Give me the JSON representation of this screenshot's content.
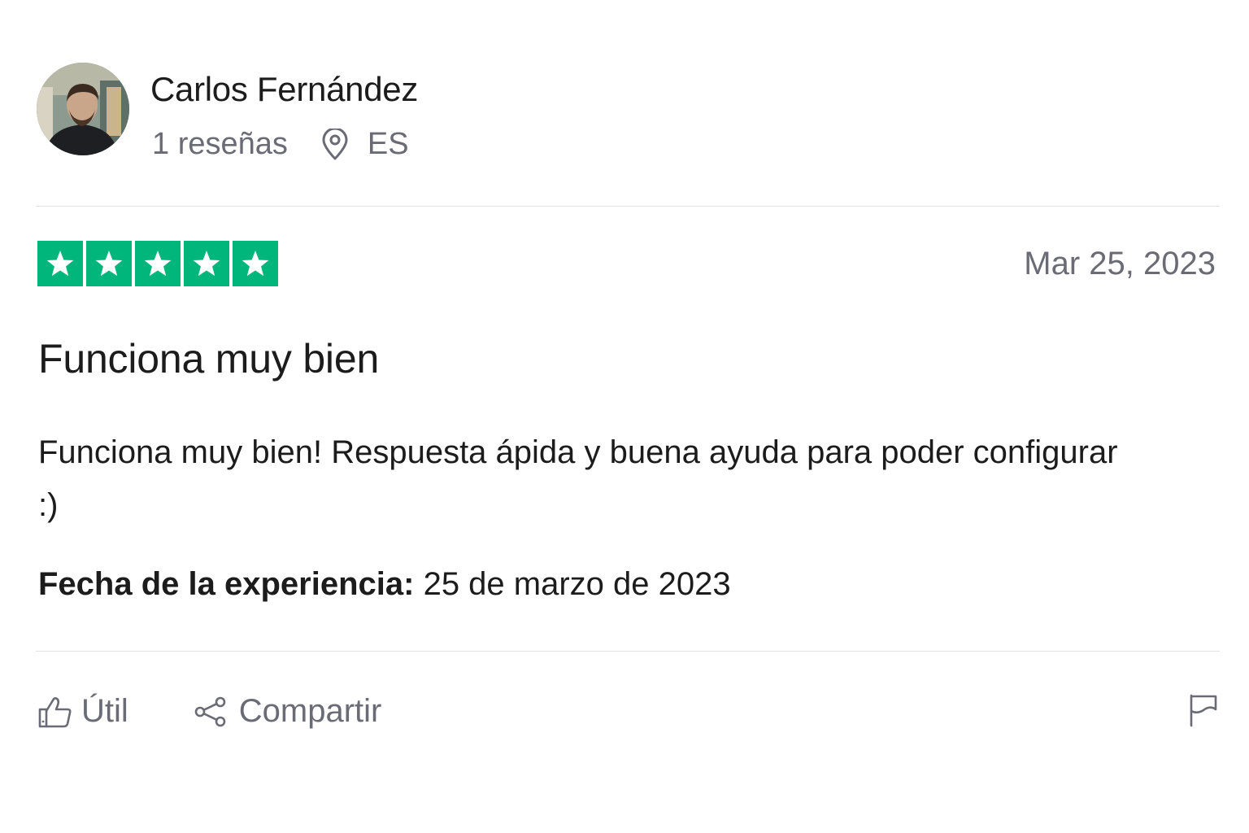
{
  "reviewer": {
    "name": "Carlos Fernández",
    "reviews_count": "1 reseñas",
    "country": "ES",
    "location_icon": "map-pin-icon"
  },
  "review": {
    "rating": 5,
    "max_rating": 5,
    "star_color": "#00b67a",
    "date": "Mar 25, 2023",
    "title": "Funciona muy bien",
    "body": "Funciona muy bien! Respuesta ápida y buena ayuda para poder configurar :)",
    "experience_label": "Fecha de la experiencia:",
    "experience_date": "25 de marzo de 2023"
  },
  "actions": {
    "useful_label": "Útil",
    "useful_icon": "thumbs-up-icon",
    "share_label": "Compartir",
    "share_icon": "share-icon",
    "report_icon": "flag-icon"
  }
}
